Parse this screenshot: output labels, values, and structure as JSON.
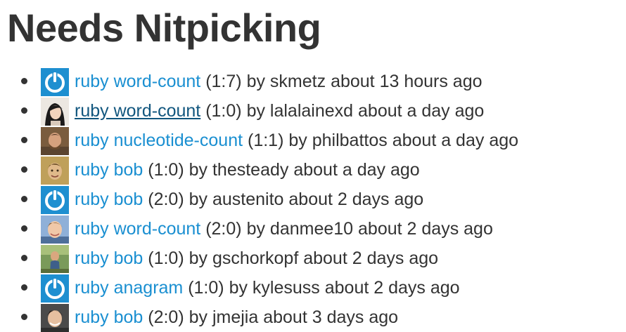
{
  "page": {
    "title": "Needs Nitpicking"
  },
  "colors": {
    "link": "#1a8fd1",
    "link_hover": "#11567e",
    "text": "#333333",
    "default_avatar_bg": "#1e8fd0"
  },
  "submissions": [
    {
      "exercise": "ruby word-count",
      "count": "(1:7)",
      "by": "by",
      "user": "skmetz",
      "time": "about 13 hours ago",
      "avatar": "default-avatar-icon"
    },
    {
      "exercise": "ruby word-count",
      "count": "(1:0)",
      "by": "by",
      "user": "lalalainexd",
      "time": "about a day ago",
      "avatar": "user-photo"
    },
    {
      "exercise": "ruby nucleotide-count",
      "count": "(1:1)",
      "by": "by",
      "user": "philbattos",
      "time": "about a day ago",
      "avatar": "user-photo"
    },
    {
      "exercise": "ruby bob",
      "count": "(1:0)",
      "by": "by",
      "user": "thesteady",
      "time": "about a day ago",
      "avatar": "user-photo"
    },
    {
      "exercise": "ruby bob",
      "count": "(2:0)",
      "by": "by",
      "user": "austenito",
      "time": "about 2 days ago",
      "avatar": "default-avatar-icon"
    },
    {
      "exercise": "ruby word-count",
      "count": "(2:0)",
      "by": "by",
      "user": "danmee10",
      "time": "about 2 days ago",
      "avatar": "user-photo"
    },
    {
      "exercise": "ruby bob",
      "count": "(1:0)",
      "by": "by",
      "user": "gschorkopf",
      "time": "about 2 days ago",
      "avatar": "user-photo"
    },
    {
      "exercise": "ruby anagram",
      "count": "(1:0)",
      "by": "by",
      "user": "kylesuss",
      "time": "about 2 days ago",
      "avatar": "default-avatar-icon"
    },
    {
      "exercise": "ruby bob",
      "count": "(2:0)",
      "by": "by",
      "user": "jmejia",
      "time": "about 3 days ago",
      "avatar": "user-photo"
    }
  ]
}
